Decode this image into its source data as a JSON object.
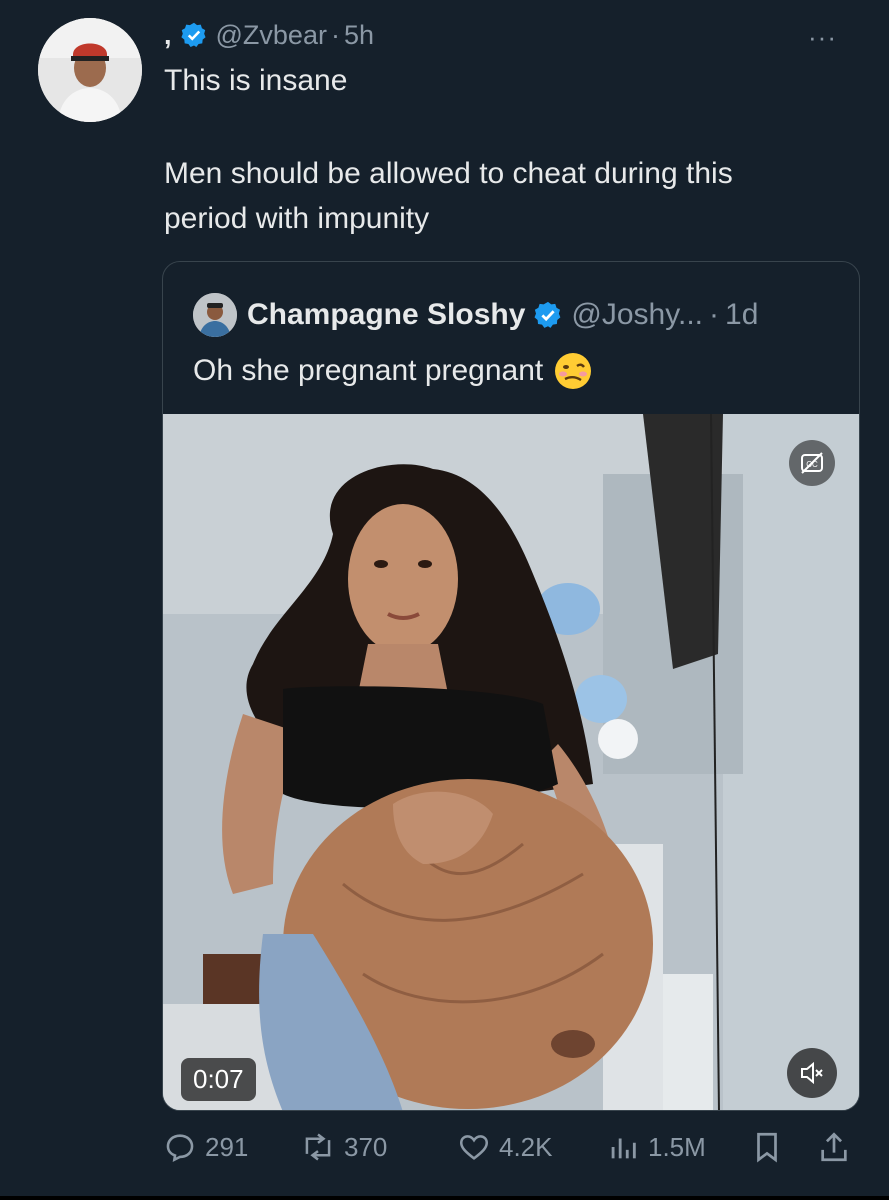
{
  "tweet": {
    "display_name": ",",
    "handle": "@Zvbear",
    "separator": "·",
    "time": "5h",
    "more_label": "···",
    "line1": "This is insane",
    "line2a": "Men should be allowed to cheat during this",
    "line2b": "period with impunity"
  },
  "quote": {
    "display_name": "Champagne Sloshy",
    "handle": "@Joshy...",
    "separator": "·",
    "time": "1d",
    "text": "Oh she pregnant pregnant",
    "emoji_name": "woozy-face-icon",
    "video_time": "0:07"
  },
  "actions": {
    "replies": "291",
    "reposts": "370",
    "likes": "4.2K",
    "views": "1.5M"
  },
  "colors": {
    "background": "#15202b",
    "text": "#e7e9ea",
    "muted": "#8b98a5",
    "verified": "#1d9bf0",
    "border": "#38444d"
  }
}
